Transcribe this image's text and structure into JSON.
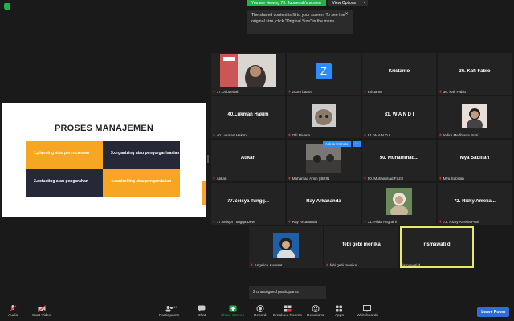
{
  "top": {
    "viewing": "You are viewing 73. Jubaedah's screen",
    "view_options": "View Options",
    "caret": "⌄",
    "tooltip": "The shared content is fit to your screen. To see the original size, click \"Original Size\" in the menu.",
    "tooltip_close": "✕"
  },
  "share": {
    "title": "PROSES MANAJEMEN",
    "cells": [
      "1.planning atau perencanaan",
      "3.organizing atau pengorganisasian",
      "2.actuating atau pengarahan",
      "4.controlling atau pengendalian"
    ]
  },
  "tiles": [
    {
      "big": "",
      "label": "37. Jubaedah"
    },
    {
      "big": "",
      "label": "zoom baa04"
    },
    {
      "big": "Kristanto",
      "label": "Kristanto"
    },
    {
      "big": "36. Kafi Fabio",
      "label": "36. Kafi Fabio"
    },
    {
      "big": "40.Lukman Hakim",
      "label": "40.Lukman Hakim"
    },
    {
      "big": "",
      "label": "Oki Rivano"
    },
    {
      "big": "81. W A N D I",
      "label": "81. W A N D I"
    },
    {
      "big": "",
      "label": "Indira Medhiana Putri"
    },
    {
      "big": "Atikah",
      "label": "Atikah"
    },
    {
      "big": "",
      "label": "Muhamad Amin | BRIN"
    },
    {
      "big": "50.  Muhammad...",
      "label": "50. Muhammad Fazril"
    },
    {
      "big": "Mya Sabillah",
      "label": "Mya Sabillah"
    },
    {
      "big": "77.Seisya  Tungg...",
      "label": "77.Seisya Tungga Dewi"
    },
    {
      "big": "Ray Arkananda",
      "label": "Ray Arkananda"
    },
    {
      "big": "",
      "label": "31. Hilda Angraini"
    },
    {
      "big": "72.  Rizky  Amelia...",
      "label": "72. Rizky Amelia Putri"
    },
    {
      "big": "",
      "label": "Angelica Kumaat"
    },
    {
      "big": "febi gebi monika",
      "label": "febi gebi monika"
    },
    {
      "big": "rismawati d",
      "label": "rismawati d"
    }
  ],
  "zoom_letter": "Z",
  "ask_unmute": "Ask to Unmute",
  "ask_more": "•••",
  "unassigned": "2 unassigned participants",
  "toolbar": {
    "audio": "Audio",
    "video": "Start Video",
    "participants": "Participants",
    "participants_count": "19",
    "chat": "Chat",
    "share": "Share Screen",
    "record": "Record",
    "breakout": "Breakout Rooms",
    "reactions": "Reactions",
    "apps": "Apps",
    "whiteboards": "Whiteboards",
    "leave": "Leave Room"
  },
  "colors": {
    "accent": "#2d8cff",
    "share_green": "#23b14d",
    "slide_yellow": "#f6a623",
    "slide_dark": "#262838",
    "active_border": "#e8e870",
    "mic_red": "#e33333"
  }
}
